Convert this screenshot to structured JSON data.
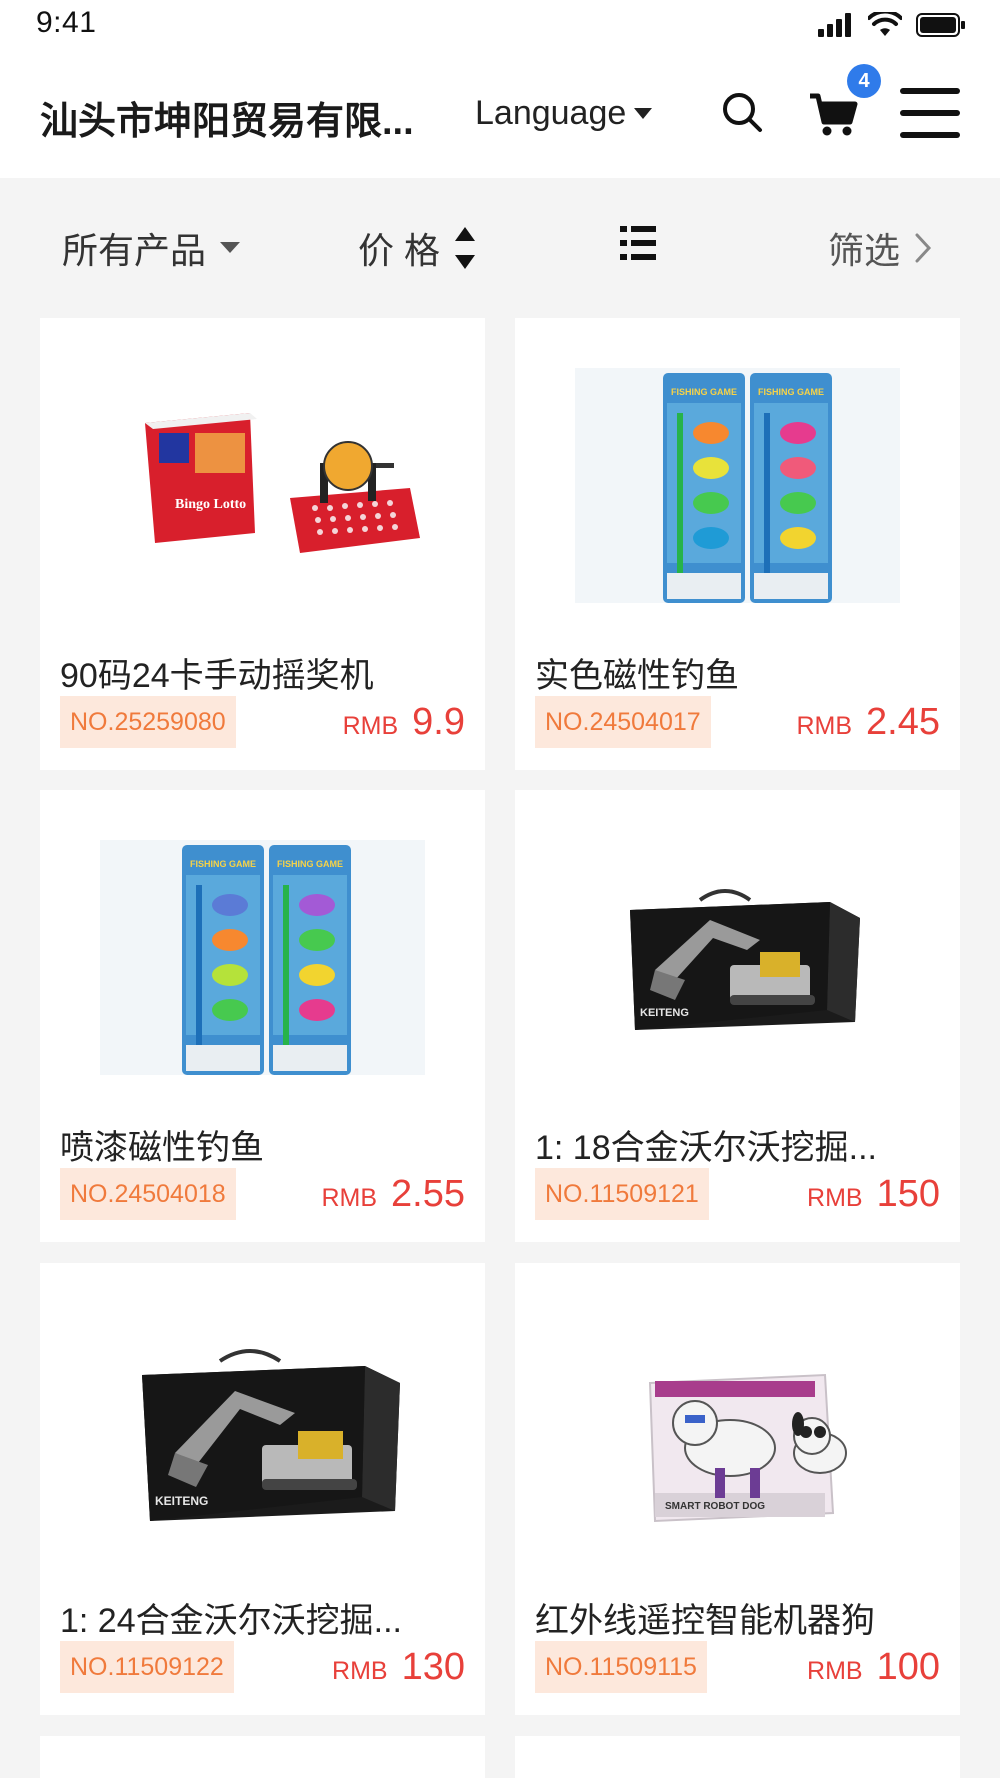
{
  "status": {
    "time": "9:41"
  },
  "header": {
    "shop_name": "汕头市坤阳贸易有限...",
    "language_label": "Language",
    "cart_count": "4"
  },
  "filters": {
    "all_products": "所有产品",
    "price": "价 格",
    "filter": "筛选"
  },
  "products": [
    {
      "title": "90码24卡手动摇奖机",
      "sku": "NO.25259080",
      "currency": "RMB",
      "price": "9.9"
    },
    {
      "title": "实色磁性钓鱼",
      "sku": "NO.24504017",
      "currency": "RMB",
      "price": "2.45"
    },
    {
      "title": "喷漆磁性钓鱼",
      "sku": "NO.24504018",
      "currency": "RMB",
      "price": "2.55"
    },
    {
      "title": "1: 18合金沃尔沃挖掘...",
      "sku": "NO.11509121",
      "currency": "RMB",
      "price": "150"
    },
    {
      "title": "1: 24合金沃尔沃挖掘...",
      "sku": "NO.11509122",
      "currency": "RMB",
      "price": "130"
    },
    {
      "title": "红外线遥控智能机器狗",
      "sku": "NO.11509115",
      "currency": "RMB",
      "price": "100"
    }
  ],
  "product_image_text": {
    "bingo_box": "Bingo Lotto",
    "fishing_brand": "FISHING GAME",
    "excavator_brand": "KEITENG",
    "robot_dog_brand": "SMART ROBOT DOG"
  },
  "colors": {
    "accent_price": "#e8403a",
    "sku_bg": "#fde8dc",
    "sku_text": "#f07a3c",
    "badge": "#2f7bea"
  }
}
